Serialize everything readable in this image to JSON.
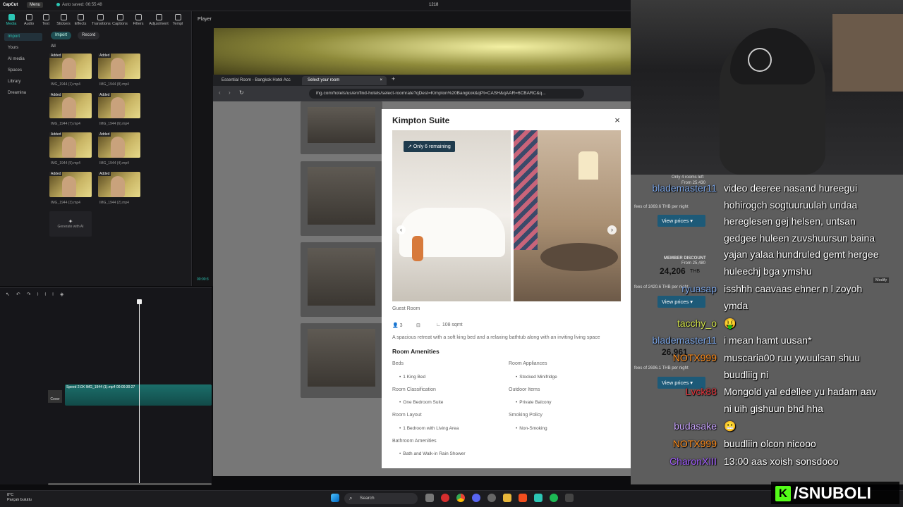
{
  "capcut": {
    "logo": "CapCut",
    "menu": "Menu",
    "autosaved": "Auto saved: 06:55:48",
    "project_id": "1218",
    "tools": [
      "Media",
      "Audio",
      "Text",
      "Stickers",
      "Effects",
      "Transitions",
      "Captions",
      "Filters",
      "Adjustment",
      "Templ"
    ],
    "side": [
      "Import",
      "Yours",
      "AI media",
      "Spaces",
      "Library",
      "Dreamina"
    ],
    "import_btn": "Import",
    "record_btn": "Record",
    "all_label": "All",
    "added": "Added",
    "clips": [
      "IMG_1944 (1).mp4",
      "IMG_1944 (8).mp4",
      "IMG_1944 (7).mp4",
      "IMG_1944 (6).mp4",
      "IMG_1944 (5).mp4",
      "IMG_1944 (4).mp4",
      "IMG_1944 (3).mp4",
      "IMG_1944 (2).mp4"
    ],
    "generate": "Generate with AI",
    "player_label": "Player",
    "timecode": "00:00:3",
    "track_label": "Speed 2.0X  IMG_1944 (1).mp4  00:00:30:27",
    "cover": "Cover",
    "modify": "Modify"
  },
  "browser": {
    "tab1": "Essential Room - Bangkok Hotel Acc",
    "tab2": "Select your room",
    "url": "ihg.com/hotels/us/en/find-hotels/select-roomrate?qDest=Kimpton%20Bangkok&qPt=CASH&qAAR=6CBARC&q..."
  },
  "modal": {
    "title": "Kimpton Suite",
    "close": "×",
    "badge": "Only 6 remaining",
    "image_caption": "Guest Room",
    "guests": "3",
    "size": "108 sqmt",
    "description": "A spacious retreat with a soft king bed and a relaxing bathtub along with an inviting living space",
    "amenities_heading": "Room Amenities",
    "col1": [
      {
        "cat": "Beds",
        "item": "1 King Bed"
      },
      {
        "cat": "Room Classification",
        "item": "One Bedroom Suite"
      },
      {
        "cat": "Room Layout",
        "item": "1 Bedroom with Living Area"
      },
      {
        "cat": "Bathroom Amenities",
        "item": "Bath and Walk-in Rain Shower"
      }
    ],
    "col2": [
      {
        "cat": "Room Appliances",
        "item": "Stocked Minifridge"
      },
      {
        "cat": "Outdoor Items",
        "item": "Private Balcony"
      },
      {
        "cat": "Smoking Policy",
        "item": "Non-Smoking"
      }
    ]
  },
  "hotel_right": {
    "rooms_left": "Only 4 rooms left",
    "from1": "From 25,430",
    "fees1": "fees of 1869.6 THB per night",
    "view_prices": "View prices",
    "member_discount": "MEMBER DISCOUNT",
    "from2": "From 25,480",
    "price2": "24,206",
    "currency": "THB",
    "fees2": "fees of 2420.6 THB per night",
    "price3": "26,961",
    "fees3": "fees of 2696.1 THB per night"
  },
  "chat": [
    {
      "user": "blademaster11",
      "color": "#7ea7e6",
      "lines": [
        "video deeree nasand hureegui",
        "hohirogch sogtuuruulah undaa",
        "hereglesen gej helsen, untsan",
        "gedgee huleen zuvshuursun baina",
        "yajan yalaa hundruled gemt hergee",
        "huleechj bga ymshu"
      ]
    },
    {
      "user": "ryuasap",
      "color": "#7ea7e6",
      "lines": [
        "isshhh caavaas ehner n l zoyoh",
        "ymda"
      ]
    },
    {
      "user": "tacchy_o",
      "color": "#d2e34b",
      "lines": [
        "🤑"
      ]
    },
    {
      "user": "blademaster11",
      "color": "#7ea7e6",
      "lines": [
        "i mean hamt uusan*"
      ]
    },
    {
      "user": "NOTX999",
      "color": "#ff8c1a",
      "lines": [
        "muscaria00 ruu ywuulsan shuu",
        "buudliig ni"
      ]
    },
    {
      "user": "Lvck88",
      "color": "#e0333a",
      "lines": [
        "Mongold yal edellee yu hadam aav",
        "ni uih gishuun bhd hha"
      ]
    },
    {
      "user": "budasake",
      "color": "#c9a4ff",
      "lines": [
        "😬"
      ]
    },
    {
      "user": "NOTX999",
      "color": "#ff8c1a",
      "lines": [
        "buudliin olcon nicooo"
      ]
    },
    {
      "user": "CharonXIII",
      "color": "#a15cff",
      "lines": [
        "13:00 aas xoish sonsdooo"
      ]
    }
  ],
  "taskbar": {
    "search": "Search",
    "temp": "8°C",
    "weather": "Parçalı bulutlu"
  },
  "brand": "/SNUBOLI",
  "colors": {
    "accent": "#2cc6b5",
    "kick": "#53fc18",
    "ihg_btn": "#1d5a78"
  }
}
